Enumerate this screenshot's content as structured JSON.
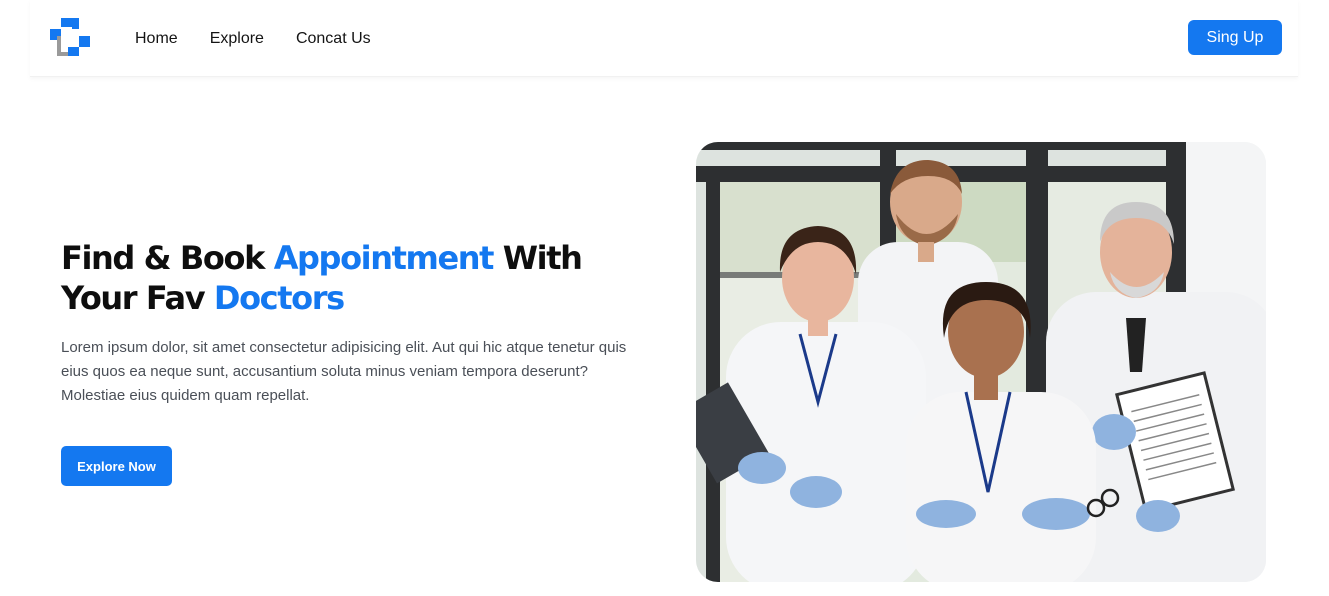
{
  "colors": {
    "accent": "#1478f0",
    "heading": "#0e0e0e",
    "body_text": "#4a4f57",
    "logo_gray": "#9a9a9a"
  },
  "navbar": {
    "logo_icon": "medical-cross-logo-icon",
    "links": [
      "Home",
      "Explore",
      "Concat Us"
    ],
    "signup_label": "Sing Up"
  },
  "hero": {
    "headline_part1": "Find & Book ",
    "headline_accent1": "Appointment",
    "headline_part2": " With",
    "headline_part3": "Your Fav ",
    "headline_accent2": "Doctors",
    "description": "Lorem ipsum dolor, sit amet consectetur adipisicing elit. Aut qui hic atque tenetur quis eius quos ea neque sunt, accusantium soluta minus veniam tempora deserunt? Molestiae eius quidem quam repellat.",
    "button_label": "Explore Now",
    "image": "doctors-group-photo"
  }
}
